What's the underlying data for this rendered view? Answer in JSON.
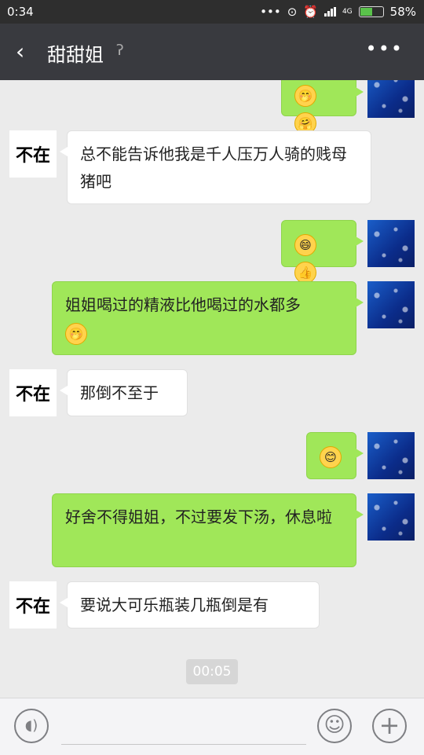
{
  "status": {
    "time": "0:34",
    "battery": "58%",
    "network": "4G",
    "battery_level": 0.58
  },
  "header": {
    "title": "甜甜姐",
    "back_icon": "‹",
    "more_icon": "•••"
  },
  "contact_avatar_text": "不在",
  "messages": [
    {
      "from": "me",
      "emojis": [
        "🤭",
        "🤗"
      ]
    },
    {
      "from": "other",
      "text": "总不能告诉他我是千人压万人骑的贱母猪吧"
    },
    {
      "from": "me",
      "emojis": [
        "😄",
        "👍"
      ]
    },
    {
      "from": "me",
      "text": "姐姐喝过的精液比他喝过的水都多",
      "emojis": [
        "🤭"
      ]
    },
    {
      "from": "other",
      "text": "那倒不至于"
    },
    {
      "from": "me",
      "emojis": [
        "😊"
      ]
    },
    {
      "from": "me",
      "text": "好舍不得姐姐，不过要发下汤，休息啦"
    },
    {
      "from": "other",
      "text": "要说大可乐瓶装几瓶倒是有"
    }
  ],
  "timestamp": "00:05",
  "input_bar": {
    "voice_icon": "voice-icon",
    "emoji_icon": "emoji-icon",
    "plus_icon": "plus-icon"
  }
}
